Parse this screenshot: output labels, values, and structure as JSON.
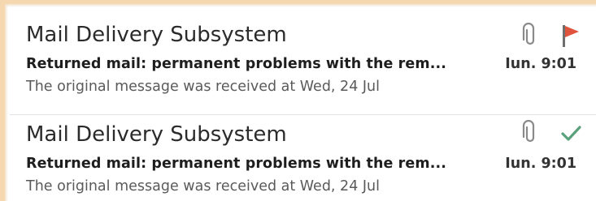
{
  "messages": [
    {
      "sender": "Mail Delivery Subsystem",
      "subject": "Returned mail: permanent problems with the rem...",
      "preview": "The original message was received at Wed, 24 Jul",
      "time": "Iun. 9:01",
      "has_attachment": true,
      "status_icon": "flag-icon",
      "status_color": "#e0533d"
    },
    {
      "sender": "Mail Delivery Subsystem",
      "subject": "Returned mail: permanent problems with the rem...",
      "preview": "The original message was received at Wed, 24 Jul",
      "time": "Iun. 9:01",
      "has_attachment": true,
      "status_icon": "checkmark-icon",
      "status_color": "#5aa07a"
    }
  ],
  "colors": {
    "selection_border": "#f6d8b0",
    "icon_gray": "#8a8a8a"
  }
}
